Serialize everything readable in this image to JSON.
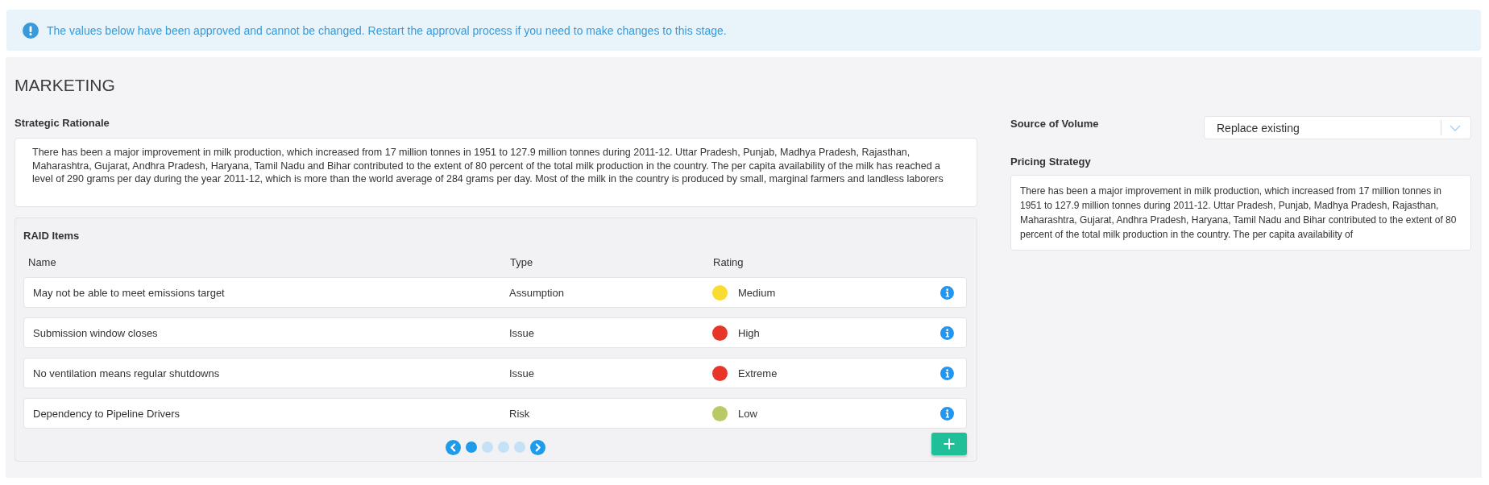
{
  "alert": {
    "message": "The values below have been approved and cannot be changed. Restart the approval process if you need to make changes to this stage."
  },
  "section": {
    "title": "MARKETING"
  },
  "strategic_rationale": {
    "label": "Strategic Rationale",
    "text": "There has been a major improvement in milk production, which increased from 17 million tonnes in 1951 to 127.9 million tonnes during 2011-12. Uttar Pradesh, Punjab, Madhya Pradesh, Rajasthan, Maharashtra, Gujarat, Andhra Pradesh, Haryana, Tamil Nadu and Bihar contributed to the extent of 80 percent of the total milk production in the country. The per capita availability of the milk has reached a level of 290 grams per day during the year 2011-12, which is more than the world average of 284 grams per day. Most of the milk in the country is produced by small, marginal farmers and landless laborers"
  },
  "raid_items": {
    "title": "RAID Items",
    "columns": [
      "Name",
      "Type",
      "Rating"
    ],
    "rows": [
      {
        "name": "May not be able to meet emissions target",
        "type": "Assumption",
        "rating": "Medium",
        "color": "#fadb2f"
      },
      {
        "name": "Submission window closes",
        "type": "Issue",
        "rating": "High",
        "color": "#e8352a"
      },
      {
        "name": "No ventilation means regular shutdowns",
        "type": "Issue",
        "rating": "Extreme",
        "color": "#e8352a"
      },
      {
        "name": "Dependency to Pipeline Drivers",
        "type": "Risk",
        "rating": "Low",
        "color": "#b8c965"
      }
    ],
    "pagination": {
      "pages": [
        {
          "selected": true
        },
        {
          "selected": false
        },
        {
          "selected": false
        },
        {
          "selected": false
        }
      ]
    }
  },
  "source_of_volume": {
    "label": "Source of Volume",
    "value": "Replace existing"
  },
  "pricing_strategy": {
    "label": "Pricing Strategy",
    "text": "There has been a major improvement in milk production, which increased from 17 million tonnes in 1951 to 127.9 million tonnes during 2011-12. Uttar Pradesh, Punjab, Madhya Pradesh, Rajasthan, Maharashtra, Gujarat, Andhra Pradesh, Haryana, Tamil Nadu and Bihar contributed to the extent of 80 percent of the total milk production in the country. The per capita availability of"
  }
}
